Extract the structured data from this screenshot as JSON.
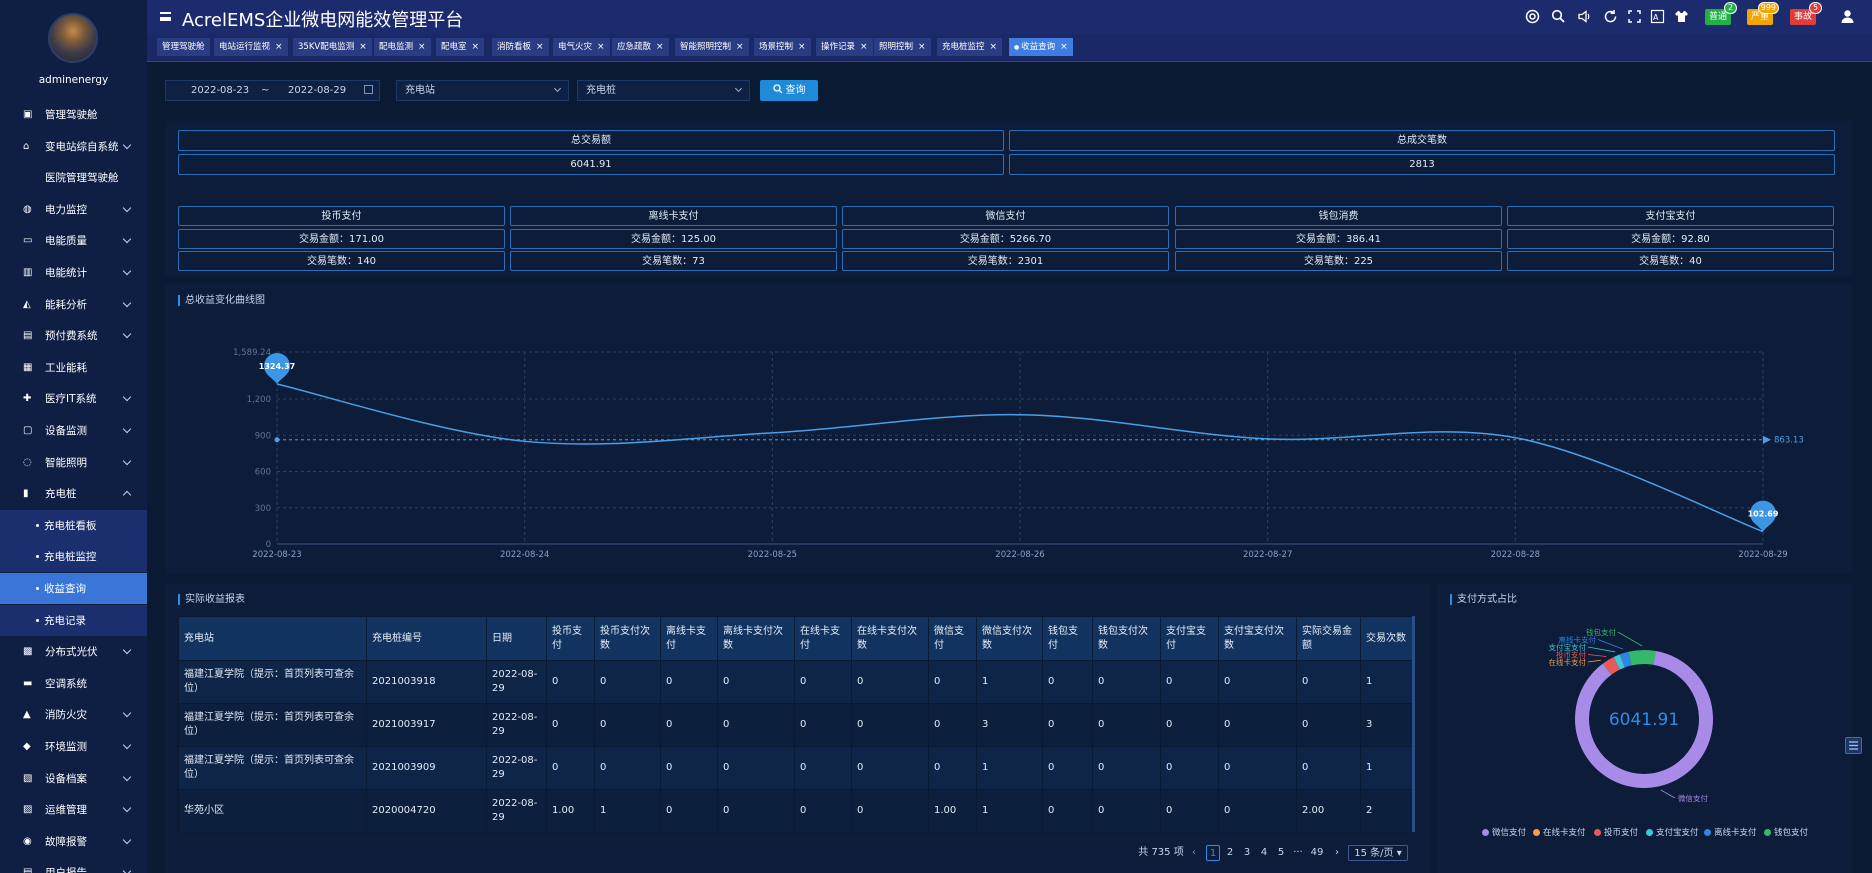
{
  "user": {
    "name": "adminenergy"
  },
  "header": {
    "title": "AcrelEMS企业微电网能效管理平台",
    "badges": [
      {
        "label": "普通",
        "count": "2",
        "color": "#23b04b"
      },
      {
        "label": "严重",
        "count": "999",
        "color": "#f0a500"
      },
      {
        "label": "事故",
        "count": "5",
        "color": "#e03c3c"
      }
    ]
  },
  "sidebar": {
    "items": [
      {
        "label": "管理驾驶舱",
        "icon": "dashboard-icon",
        "chev": false
      },
      {
        "label": "变电站综自系统",
        "icon": "home-icon",
        "chev": true
      },
      {
        "label": "医院管理驾驶舱",
        "icon": "",
        "chev": false
      },
      {
        "label": "电力监控",
        "icon": "globe-icon",
        "chev": true
      },
      {
        "label": "电能质量",
        "icon": "monitor-icon",
        "chev": true
      },
      {
        "label": "电能统计",
        "icon": "bar-chart-icon",
        "chev": true
      },
      {
        "label": "能耗分析",
        "icon": "area-chart-icon",
        "chev": true
      },
      {
        "label": "预付费系统",
        "icon": "wallet-icon",
        "chev": true
      },
      {
        "label": "工业能耗",
        "icon": "factory-icon",
        "chev": false
      },
      {
        "label": "医疗IT系统",
        "icon": "medical-icon",
        "chev": true
      },
      {
        "label": "设备监测",
        "icon": "device-icon",
        "chev": true
      },
      {
        "label": "智能照明",
        "icon": "bulb-icon",
        "chev": true
      },
      {
        "label": "充电桩",
        "icon": "charger-icon",
        "chev": true
      }
    ],
    "sub_items": [
      {
        "label": "充电桩看板"
      },
      {
        "label": "充电桩监控"
      },
      {
        "label": "收益查询"
      },
      {
        "label": "充电记录"
      }
    ],
    "items_after": [
      {
        "label": "分布式光伏",
        "icon": "solar-icon",
        "chev": true
      },
      {
        "label": "空调系统",
        "icon": "aircon-icon",
        "chev": false
      },
      {
        "label": "消防火灾",
        "icon": "fire-icon",
        "chev": true
      },
      {
        "label": "环境监测",
        "icon": "env-icon",
        "chev": true
      },
      {
        "label": "设备档案",
        "icon": "archive-icon",
        "chev": true
      },
      {
        "label": "运维管理",
        "icon": "ops-icon",
        "chev": true
      },
      {
        "label": "故障报警",
        "icon": "alarm-icon",
        "chev": true
      },
      {
        "label": "用户报告",
        "icon": "report-icon",
        "chev": true
      }
    ]
  },
  "tabs": [
    {
      "label": "管理驾驶舱",
      "closable": false
    },
    {
      "label": "电站运行监视",
      "closable": true
    },
    {
      "label": "35KV配电监测",
      "closable": true
    },
    {
      "label": "配电监测",
      "closable": true
    },
    {
      "label": "配电室",
      "closable": true
    },
    {
      "label": "消防看板",
      "closable": true
    },
    {
      "label": "电气火灾",
      "closable": true
    },
    {
      "label": "应急疏散",
      "closable": true
    },
    {
      "label": "智能照明控制",
      "closable": true
    },
    {
      "label": "场景控制",
      "closable": true
    },
    {
      "label": "操作记录",
      "closable": true
    },
    {
      "label": "照明控制",
      "closable": true
    },
    {
      "label": "充电桩监控",
      "closable": true
    },
    {
      "label": "收益查询",
      "closable": true
    }
  ],
  "filter": {
    "date_start": "2022-08-23",
    "date_sep": "~",
    "date_end": "2022-08-29",
    "station": "充电站",
    "pile": "充电桩",
    "query_label": "查询"
  },
  "summary": {
    "total_amount_label": "总交易额",
    "total_amount": "6041.91",
    "total_count_label": "总成交笔数",
    "total_count": "2813"
  },
  "methods": [
    {
      "name": "投币支付",
      "amount": "交易金额：171.00",
      "count": "交易笔数：140"
    },
    {
      "name": "离线卡支付",
      "amount": "交易金额：125.00",
      "count": "交易笔数：73"
    },
    {
      "name": "微信支付",
      "amount": "交易金额：5266.70",
      "count": "交易笔数：2301"
    },
    {
      "name": "钱包消费",
      "amount": "交易金额：386.41",
      "count": "交易笔数：225"
    },
    {
      "name": "支付宝支付",
      "amount": "交易金额：92.80",
      "count": "交易笔数：40"
    }
  ],
  "chart_title": "总收益变化曲线图",
  "chart_data": {
    "type": "line",
    "title": "总收益变化曲线图",
    "x": [
      "2022-08-23",
      "2022-08-24",
      "2022-08-25",
      "2022-08-26",
      "2022-08-27",
      "2022-08-28",
      "2022-08-29"
    ],
    "series": [
      {
        "values": [
          1324.37,
          850,
          920,
          1070,
          870,
          880,
          102.69
        ]
      }
    ],
    "ylim": [
      0,
      1589.24
    ],
    "yticks": [
      "0",
      "300",
      "600",
      "900",
      "1,200",
      "1,589.24"
    ],
    "max_label": "1324.37",
    "min_label": "102.69",
    "avg_value": 863.13,
    "avg_label": "863.13",
    "grid": true
  },
  "report": {
    "title": "实际收益报表",
    "columns": [
      "充电站",
      "充电桩编号",
      "日期",
      "投币支付",
      "投币支付次数",
      "离线卡支付",
      "离线卡支付次数",
      "在线卡支付",
      "在线卡支付次数",
      "微信支付",
      "微信支付次数",
      "钱包支付",
      "钱包支付次数",
      "支付宝支付",
      "支付宝支付次数",
      "实际交易金额",
      "交易次数"
    ],
    "rows": [
      [
        "福建江夏学院（提示：首页列表可查余位）",
        "2021003918",
        "2022-08-29",
        "0",
        "0",
        "0",
        "0",
        "0",
        "0",
        "0",
        "1",
        "0",
        "0",
        "0",
        "0",
        "0",
        "1"
      ],
      [
        "福建江夏学院（提示：首页列表可查余位）",
        "2021003917",
        "2022-08-29",
        "0",
        "0",
        "0",
        "0",
        "0",
        "0",
        "0",
        "3",
        "0",
        "0",
        "0",
        "0",
        "0",
        "3"
      ],
      [
        "福建江夏学院（提示：首页列表可查余位）",
        "2021003909",
        "2022-08-29",
        "0",
        "0",
        "0",
        "0",
        "0",
        "0",
        "0",
        "1",
        "0",
        "0",
        "0",
        "0",
        "0",
        "1"
      ],
      [
        "华苑小区",
        "2020004720",
        "2022-08-29",
        "1.00",
        "1",
        "0",
        "0",
        "0",
        "0",
        "1.00",
        "1",
        "0",
        "0",
        "0",
        "0",
        "2.00",
        "2"
      ]
    ]
  },
  "pager": {
    "total": "共 735 项",
    "pages": [
      "1",
      "2",
      "3",
      "4",
      "5",
      "···",
      "49"
    ],
    "page_size": "15 条/页"
  },
  "pie": {
    "title": "支付方式占比",
    "center_label": "6041.91",
    "chart_data": {
      "type": "pie",
      "labels": [
        "微信支付",
        "在线卡支付",
        "投币支付",
        "支付宝支付",
        "离线卡支付",
        "钱包支付"
      ],
      "values": [
        5266.7,
        0,
        171.0,
        92.8,
        125.0,
        386.41
      ],
      "colors": [
        "#a88be8",
        "#f0a050",
        "#e85a5a",
        "#3cc8d8",
        "#2e86e0",
        "#34b86a"
      ]
    }
  }
}
